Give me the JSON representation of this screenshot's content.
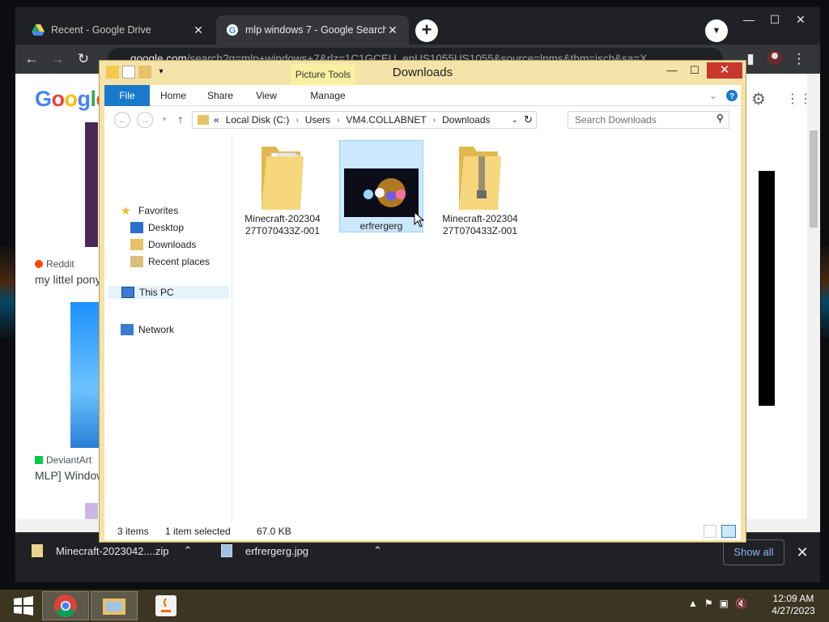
{
  "chrome": {
    "tabs": [
      {
        "title": "Recent - Google Drive",
        "active": false
      },
      {
        "title": "mlp windows 7 - Google Search",
        "active": true
      }
    ],
    "address": {
      "host": "google.com",
      "path": "/search?q=mlp+windows+7&rlz=1C1GCEU_enUS1055US1055&source=lnms&tbm=isch&sa=X"
    },
    "page": {
      "logo": "Google",
      "results": [
        {
          "source": "Reddit",
          "title": "my littel pony"
        },
        {
          "source": "DeviantArt",
          "title": "MLP] Window"
        }
      ]
    },
    "downloads": {
      "items": [
        {
          "name": "Minecraft-2023042....zip"
        },
        {
          "name": "erfrergerg.jpg"
        }
      ],
      "show_all": "Show all"
    }
  },
  "explorer": {
    "title": "Downloads",
    "context_tab": "Picture Tools",
    "ribbon_tabs": [
      "File",
      "Home",
      "Share",
      "View",
      "Manage"
    ],
    "breadcrumb": [
      "Local Disk (C:)",
      "Users",
      "VM4.COLLABNET",
      "Downloads"
    ],
    "breadcrumb_prefix": "«",
    "search_placeholder": "Search Downloads",
    "nav": {
      "favorites": "Favorites",
      "desktop": "Desktop",
      "downloads": "Downloads",
      "recent": "Recent places",
      "this_pc": "This PC",
      "network": "Network"
    },
    "files": [
      {
        "line1": "Minecraft-202304",
        "line2": "27T070433Z-001",
        "type": "folder"
      },
      {
        "line1": "erfrergerg",
        "line2": "",
        "type": "image",
        "selected": true
      },
      {
        "line1": "Minecraft-202304",
        "line2": "27T070433Z-001",
        "type": "zip"
      }
    ],
    "status": {
      "count": "3 items",
      "selected": "1 item selected",
      "size": "67.0 KB"
    }
  },
  "taskbar": {
    "clock_time": "12:09 AM",
    "clock_date": "4/27/2023"
  },
  "colors": {
    "explorer_frame": "#f4e3a9",
    "file_tab": "#1979ca",
    "close_red": "#c8372c",
    "selection": "#cce8ff"
  }
}
